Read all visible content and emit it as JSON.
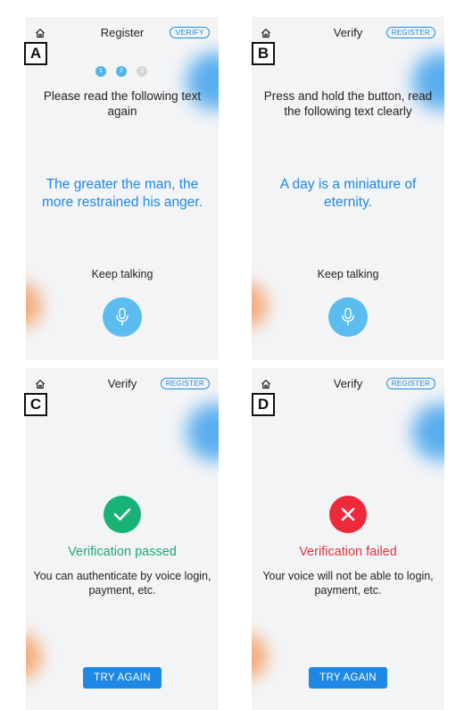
{
  "panels": {
    "a": {
      "badge": "A",
      "title": "Register",
      "mode_button": "VERIFY",
      "steps": [
        "1",
        "2",
        "3"
      ],
      "steps_completed": 2,
      "instruction": "Please read the following text again",
      "phrase": "The greater the man, the more restrained his anger.",
      "hint": "Keep talking",
      "mic_icon": "microphone-icon"
    },
    "b": {
      "badge": "B",
      "title": "Verify",
      "mode_button": "REGISTER",
      "instruction": "Press and hold the button, read the following text clearly",
      "phrase": "A day is a miniature of eternity.",
      "hint": "Keep talking",
      "mic_icon": "microphone-icon"
    },
    "c": {
      "badge": "C",
      "title": "Verify",
      "mode_button": "REGISTER",
      "status_icon": "checkmark-icon",
      "status_title": "Verification passed",
      "status_desc": "You can authenticate by voice login, payment, etc.",
      "action_button": "TRY AGAIN"
    },
    "d": {
      "badge": "D",
      "title": "Verify",
      "mode_button": "REGISTER",
      "status_icon": "cross-icon",
      "status_title": "Verification failed",
      "status_desc": "Your voice will not be able to login, payment, etc.",
      "action_button": "TRY AGAIN"
    }
  },
  "colors": {
    "accent_blue": "#1e88e5",
    "mic_blue": "#5bbcf0",
    "success_green": "#18b277",
    "error_red": "#ee2a3a",
    "panel_bg": "#f3f4f6"
  }
}
